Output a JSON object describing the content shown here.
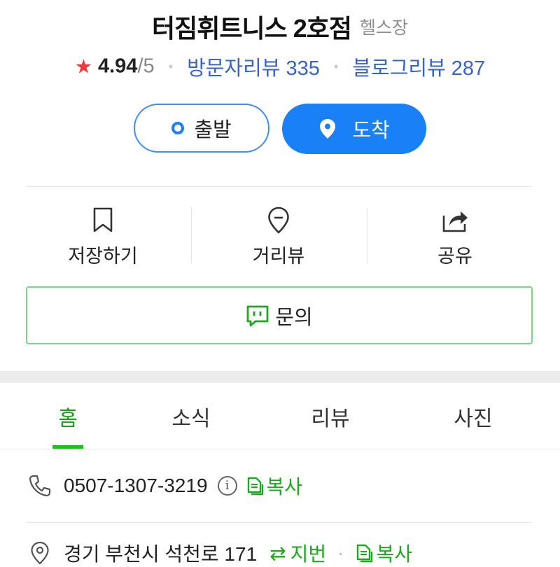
{
  "header": {
    "title": "터짐휘트니스 2호점",
    "category": "헬스장"
  },
  "rating": {
    "star": "★",
    "score": "4.94",
    "max": "/5",
    "visitor_reviews": "방문자리뷰 335",
    "blog_reviews": "블로그리뷰 287"
  },
  "route": {
    "depart_label": "출발",
    "arrive_label": "도착"
  },
  "actions": {
    "save_label": "저장하기",
    "streetview_label": "거리뷰",
    "share_label": "공유"
  },
  "inquiry": {
    "label": "문의"
  },
  "tabs": [
    {
      "label": "홈",
      "active": true
    },
    {
      "label": "소식",
      "active": false
    },
    {
      "label": "리뷰",
      "active": false
    },
    {
      "label": "사진",
      "active": false
    }
  ],
  "info": {
    "phone": "0507-1307-3219",
    "info_glyph": "i",
    "copy_label": "복사",
    "address": "경기 부천시 석천로 171",
    "jibun_label": "지번",
    "address_copy_label": "복사",
    "separator": "·"
  },
  "colors": {
    "accent_blue": "#1a80f5",
    "link_blue": "#3563c7",
    "green": "#1fa81f",
    "star_red": "#ee3a3a"
  },
  "icons": {
    "depart": "ring-icon",
    "arrive": "location-pin-icon",
    "save": "bookmark-icon",
    "streetview": "map-pin-outline-icon",
    "share": "share-icon",
    "inquiry": "chat-icon",
    "phone": "phone-icon",
    "address": "location-icon",
    "copy": "copy-icon",
    "swap": "swap-arrows-icon"
  }
}
